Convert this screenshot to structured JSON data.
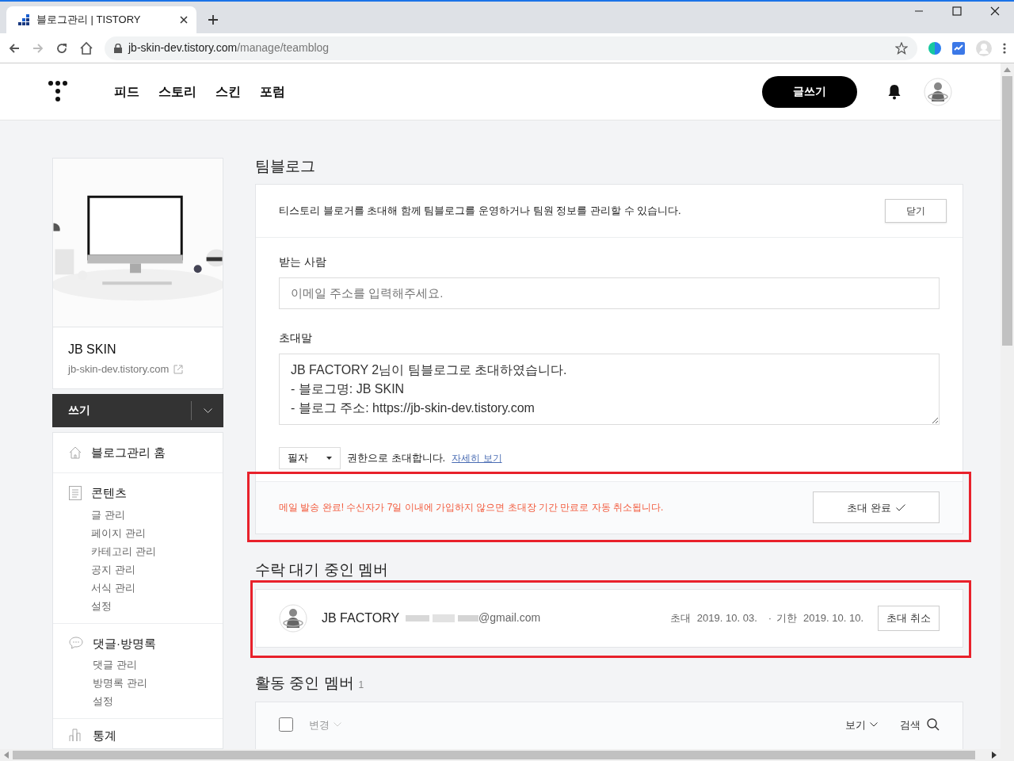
{
  "browser": {
    "tab_title": "블로그관리 | TISTORY",
    "url_host": "jb-skin-dev.tistory.com",
    "url_path": "/manage/teamblog"
  },
  "header": {
    "nav": [
      {
        "label": "피드"
      },
      {
        "label": "스토리"
      },
      {
        "label": "스킨"
      },
      {
        "label": "포럼"
      }
    ],
    "write_button": "글쓰기"
  },
  "sidebar": {
    "blog_name": "JB SKIN",
    "blog_url": "jb-skin-dev.tistory.com",
    "write_label": "쓰기",
    "home": {
      "label": "블로그관리 홈",
      "kind": "home"
    },
    "groups": [
      {
        "title": "콘텐츠",
        "kind": "document",
        "items": [
          "글 관리",
          "페이지 관리",
          "카테고리 관리",
          "공지 관리",
          "서식 관리",
          "설정"
        ]
      },
      {
        "title": "댓글·방명록",
        "kind": "comment",
        "items": [
          "댓글 관리",
          "방명록 관리",
          "설정"
        ]
      },
      {
        "title": "통계",
        "kind": "chart"
      }
    ]
  },
  "main": {
    "title": "팀블로그",
    "invite": {
      "intro": "티스토리 블로거를 초대해 함께 팀블로그를 운영하거나 팀원 정보를 관리할 수 있습니다.",
      "close_button": "닫기",
      "recipient_label": "받는 사람",
      "recipient_placeholder": "이메일 주소를 입력해주세요.",
      "message_label": "초대말",
      "message": "JB FACTORY 2님이 팀블로그로 초대하였습니다.\n- 블로그명: JB SKIN\n- 블로그 주소: https://jb-skin-dev.tistory.com",
      "role": "필자",
      "role_suffix": "권한으로 초대합니다.",
      "detail_link": "자세히 보기",
      "notice": {
        "text": "메일 발송 완료! 수신자가 7일 이내에 가입하지 않으면 초대장 기간 만료로 자동 취소됩니다.",
        "button": "초대 완료",
        "highlighted": true
      }
    },
    "pending": {
      "title": "수락 대기 중인 멤버",
      "highlighted": true,
      "members": [
        {
          "name": "JB FACTORY",
          "email": "@gmail.com",
          "invited_label": "초대",
          "invited_date": "2019. 10. 03.",
          "separator": "·",
          "expires_label": "기한",
          "expires_date": "2019. 10. 10.",
          "cancel_button": "초대 취소"
        }
      ]
    },
    "active": {
      "title": "활동 중인 멤버",
      "count": "1",
      "toolbar": {
        "select_all_checked": false,
        "change": "변경",
        "view": "보기",
        "search": "검색"
      }
    }
  }
}
